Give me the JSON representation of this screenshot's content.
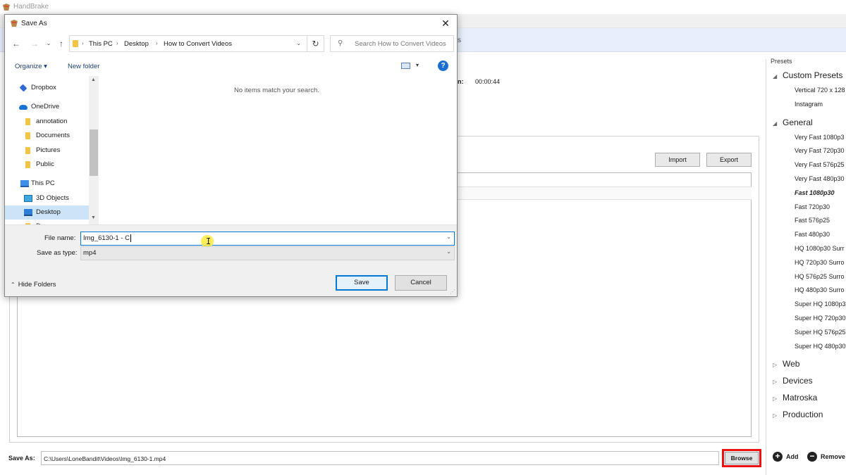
{
  "app": {
    "title": "HandBrake"
  },
  "source_fragment": "s",
  "summary": {
    "duration_label": "n:",
    "duration_value": "00:00:44"
  },
  "queue_tab": {
    "import_label": "Import",
    "export_label": "Export"
  },
  "destination": {
    "label": "Save As:",
    "path": "C:\\Users\\LoneBandit\\Videos\\Img_6130-1.mp4",
    "browse_label": "Browse"
  },
  "presets": {
    "heading": "Presets",
    "groups": [
      {
        "label": "Custom Presets",
        "expanded": true,
        "items": [
          {
            "label": "Vertical 720 x 128"
          },
          {
            "label": "Instagram"
          }
        ]
      },
      {
        "label": "General",
        "expanded": true,
        "items": [
          {
            "label": "Very Fast 1080p3"
          },
          {
            "label": "Very Fast 720p30"
          },
          {
            "label": "Very Fast 576p25"
          },
          {
            "label": "Very Fast 480p30"
          },
          {
            "label": "Fast 1080p30",
            "active": true
          },
          {
            "label": "Fast 720p30"
          },
          {
            "label": "Fast 576p25"
          },
          {
            "label": "Fast 480p30"
          },
          {
            "label": "HQ 1080p30 Surr"
          },
          {
            "label": "HQ 720p30 Surro"
          },
          {
            "label": "HQ 576p25 Surro"
          },
          {
            "label": "HQ 480p30 Surro"
          },
          {
            "label": "Super HQ 1080p3"
          },
          {
            "label": "Super HQ 720p30"
          },
          {
            "label": "Super HQ 576p25"
          },
          {
            "label": "Super HQ 480p30"
          }
        ]
      },
      {
        "label": "Web",
        "expanded": false
      },
      {
        "label": "Devices",
        "expanded": false
      },
      {
        "label": "Matroska",
        "expanded": false
      },
      {
        "label": "Production",
        "expanded": false
      }
    ],
    "add_label": "Add",
    "remove_label": "Remove"
  },
  "dialog": {
    "title": "Save As",
    "breadcrumb": [
      "This PC",
      "Desktop",
      "How to Convert Videos"
    ],
    "search_placeholder": "Search How to Convert Videos",
    "organize_label": "Organize ▾",
    "new_folder_label": "New folder",
    "nav_items": [
      {
        "label": "Dropbox",
        "icon": "dropbox-icon"
      },
      {
        "label": "OneDrive",
        "icon": "cloud-icon"
      },
      {
        "label": "annotation",
        "icon": "folder-icon"
      },
      {
        "label": "Documents",
        "icon": "folder-icon"
      },
      {
        "label": "Pictures",
        "icon": "folder-icon"
      },
      {
        "label": "Public",
        "icon": "folder-icon"
      },
      {
        "label": "This PC",
        "icon": "computer-icon"
      },
      {
        "label": "3D Objects",
        "icon": "cube-icon"
      },
      {
        "label": "Desktop",
        "icon": "desktop-icon",
        "selected": true
      },
      {
        "label": "D",
        "icon": "folder-icon"
      }
    ],
    "empty_message": "No items match your search.",
    "file_name_label": "File name:",
    "file_name_value": "Img_6130-1 - C",
    "save_type_label": "Save as type:",
    "save_type_value": "mp4",
    "hide_folders_label": "Hide Folders",
    "save_label": "Save",
    "cancel_label": "Cancel"
  },
  "colors": {
    "accent": "#0078d7",
    "highlight_box": "#ee1111",
    "source_bar": "#e8eefb",
    "help_blue": "#1c6fd1"
  }
}
